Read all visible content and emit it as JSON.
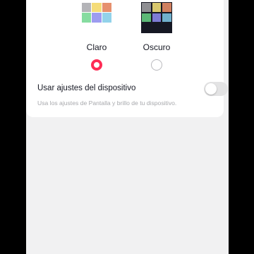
{
  "theme": {
    "options": [
      {
        "id": "light",
        "label": "Claro",
        "selected": true,
        "preview_colors": [
          "#b4b4b8",
          "#f5dc78",
          "#e6906e",
          "#86dca0",
          "#9d9cf0",
          "#92d2ea",
          "",
          "",
          ""
        ]
      },
      {
        "id": "dark",
        "label": "Oscuro",
        "selected": false,
        "preview_colors": [
          "#8f8f93",
          "#d8c86e",
          "#d0805f",
          "#5cb877",
          "#7d7bd4",
          "#70b0cc",
          "",
          "",
          ""
        ]
      }
    ]
  },
  "device_settings": {
    "label": "Usar ajustes del dispositivo",
    "enabled": false,
    "description": "Usa los ajustes de Pantalla y brillo de tu dispositivo."
  },
  "colors": {
    "accent": "#fe2c55",
    "toggle_off": "#e3e3e4",
    "background": "#f1f1f2"
  }
}
